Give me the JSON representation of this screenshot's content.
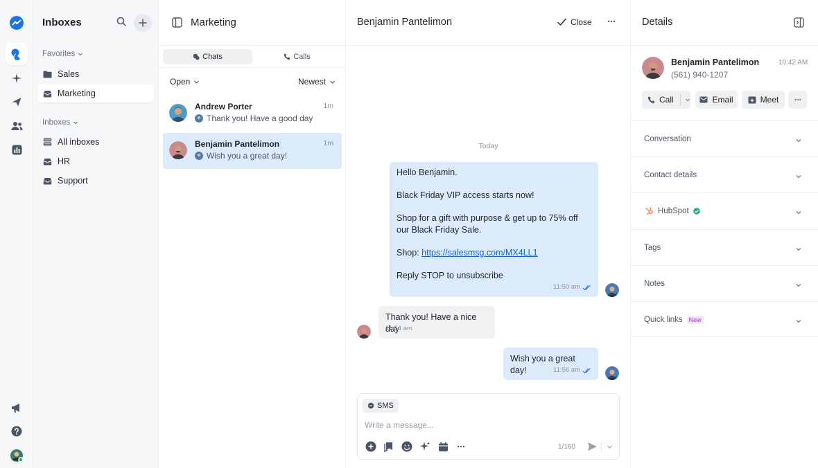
{
  "colors": {
    "accent": "#1a73e8",
    "bubble_out": "#dcebfb",
    "bubble_in": "#f0f1f3",
    "hubspot": "#ff7a59",
    "verified": "#22b573",
    "new_badge": "#a233c9"
  },
  "rail": {
    "icons": [
      "logo-icon",
      "chats-icon",
      "sparkle-icon",
      "send-icon",
      "contacts-icon",
      "reports-icon",
      "megaphone-icon",
      "help-icon",
      "user-avatar"
    ]
  },
  "inboxes": {
    "title": "Inboxes",
    "favorites_label": "Favorites",
    "favorites": [
      {
        "label": "Sales",
        "icon": "folder-icon"
      },
      {
        "label": "Marketing",
        "icon": "inbox-icon",
        "active": true
      }
    ],
    "inboxes_label": "Inboxes",
    "items": [
      {
        "label": "All inboxes",
        "icon": "stacked-inbox-icon"
      },
      {
        "label": "HR",
        "icon": "inbox-icon"
      },
      {
        "label": "Support",
        "icon": "inbox-icon"
      }
    ]
  },
  "conversations": {
    "title": "Marketing",
    "tabs": [
      {
        "label": "Chats",
        "active": true
      },
      {
        "label": "Calls"
      }
    ],
    "filter_status": "Open",
    "filter_sort": "Newest",
    "items": [
      {
        "name": "Andrew Porter",
        "time": "1m",
        "preview": "Thank you! Have a good day"
      },
      {
        "name": "Benjamin Pantelimon",
        "time": "1m",
        "preview": "Wish you a great day!",
        "active": true
      }
    ]
  },
  "chat": {
    "title": "Benjamin Pantelimon",
    "close_label": "Close",
    "day_label": "Today",
    "messages": {
      "m1": {
        "line1": "Hello Benjamin.",
        "line2": "Black Friday VIP access starts now!",
        "line3": "Shop for a gift with purpose & get up to 75% off our Black Friday Sale.",
        "line4_prefix": "Shop: ",
        "line4_link": "https://salesmsg.com/MX4LL1",
        "line5": "Reply STOP to unsubscribe",
        "time": "11:50 am"
      },
      "m2": {
        "text": "Thank you! Have a nice day",
        "time": "11:54 am"
      },
      "m3": {
        "text": "Wish you a great day!",
        "time": "11:56 am"
      }
    },
    "composer": {
      "channel": "SMS",
      "placeholder": "Write a message...",
      "counter": "1/160"
    }
  },
  "details": {
    "title": "Details",
    "contact": {
      "name": "Benjamin Pantelimon",
      "phone": "(561) 940-1207",
      "time": "10:42 AM"
    },
    "actions": {
      "call": "Call",
      "email": "Email",
      "meet": "Meet"
    },
    "sections": {
      "conversation": "Conversation",
      "contact_details": "Contact details",
      "hubspot": "HubSpot",
      "tags": "Tags",
      "notes": "Notes",
      "quick_links": "Quick links",
      "new_badge": "New"
    }
  }
}
